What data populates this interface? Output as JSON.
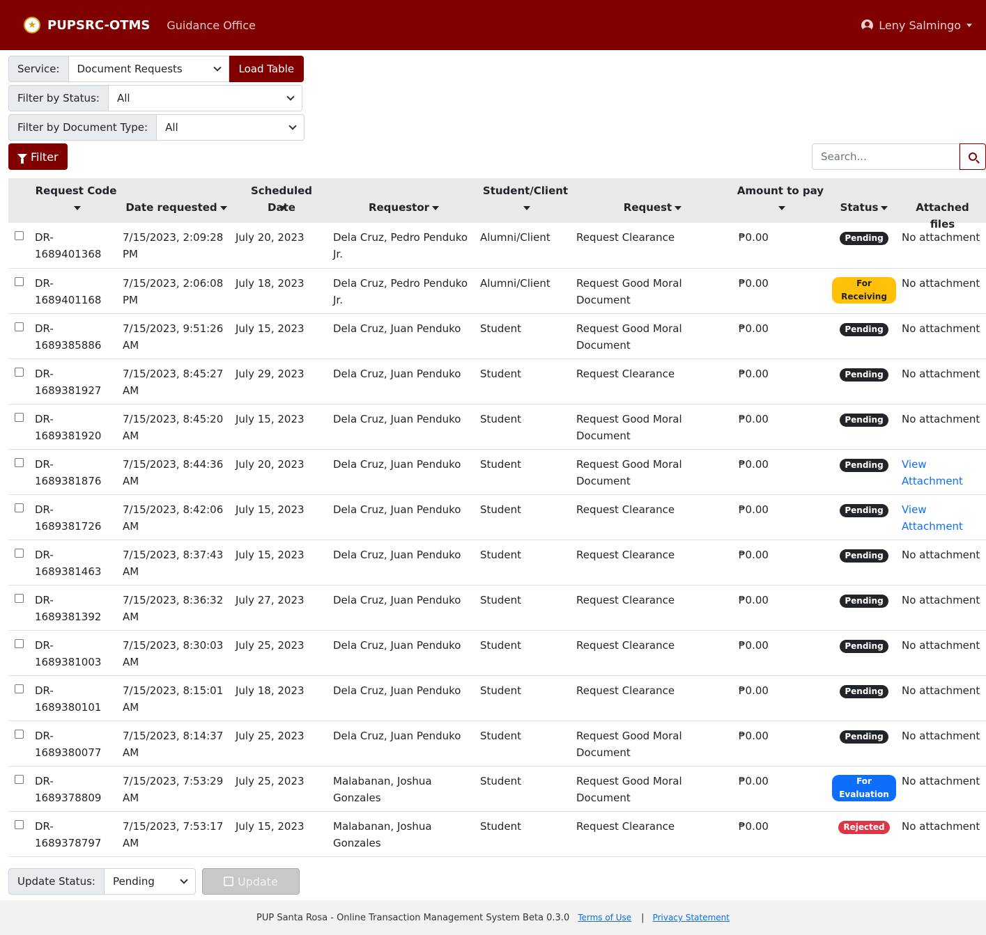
{
  "nav": {
    "brand": "PUPSRC-OTMS",
    "office": "Guidance Office",
    "user": "Leny Salmingo"
  },
  "controls": {
    "service_label": "Service:",
    "service_value": "Document Requests",
    "load_button": "Load Table",
    "status_label": "Filter by Status:",
    "status_value": "All",
    "doctype_label": "Filter by Document Type:",
    "doctype_value": "All",
    "filter_button": "Filter",
    "search_placeholder": "Search..."
  },
  "table": {
    "headers": {
      "code": "Request Code",
      "date": "Date requested",
      "scheduled": "Scheduled Date",
      "requestor": "Requestor",
      "student": "Student/Client",
      "request": "Request",
      "amount": "Amount to pay",
      "status": "Status",
      "files": "Attached files"
    },
    "rows": [
      {
        "code": "DR-1689401368",
        "date": "7/15/2023, 2:09:28 PM",
        "scheduled": "July 20, 2023",
        "requestor": "Dela Cruz, Pedro Penduko Jr.",
        "student": "Alumni/Client",
        "request": "Request Clearance",
        "amount": "₱0.00",
        "status": "Pending",
        "files": "No attachment"
      },
      {
        "code": "DR-1689401168",
        "date": "7/15/2023, 2:06:08 PM",
        "scheduled": "July 18, 2023",
        "requestor": "Dela Cruz, Pedro Penduko Jr.",
        "student": "Alumni/Client",
        "request": "Request Good Moral Document",
        "amount": "₱0.00",
        "status": "For Receiving",
        "files": "No attachment"
      },
      {
        "code": "DR-1689385886",
        "date": "7/15/2023, 9:51:26 AM",
        "scheduled": "July 15, 2023",
        "requestor": "Dela Cruz, Juan Penduko",
        "student": "Student",
        "request": "Request Good Moral Document",
        "amount": "₱0.00",
        "status": "Pending",
        "files": "No attachment"
      },
      {
        "code": "DR-1689381927",
        "date": "7/15/2023, 8:45:27 AM",
        "scheduled": "July 29, 2023",
        "requestor": "Dela Cruz, Juan Penduko",
        "student": "Student",
        "request": "Request Clearance",
        "amount": "₱0.00",
        "status": "Pending",
        "files": "No attachment"
      },
      {
        "code": "DR-1689381920",
        "date": "7/15/2023, 8:45:20 AM",
        "scheduled": "July 15, 2023",
        "requestor": "Dela Cruz, Juan Penduko",
        "student": "Student",
        "request": "Request Good Moral Document",
        "amount": "₱0.00",
        "status": "Pending",
        "files": "No attachment"
      },
      {
        "code": "DR-1689381876",
        "date": "7/15/2023, 8:44:36 AM",
        "scheduled": "July 20, 2023",
        "requestor": "Dela Cruz, Juan Penduko",
        "student": "Student",
        "request": "Request Good Moral Document",
        "amount": "₱0.00",
        "status": "Pending",
        "files": "View Attachment"
      },
      {
        "code": "DR-1689381726",
        "date": "7/15/2023, 8:42:06 AM",
        "scheduled": "July 15, 2023",
        "requestor": "Dela Cruz, Juan Penduko",
        "student": "Student",
        "request": "Request Clearance",
        "amount": "₱0.00",
        "status": "Pending",
        "files": "View Attachment"
      },
      {
        "code": "DR-1689381463",
        "date": "7/15/2023, 8:37:43 AM",
        "scheduled": "July 15, 2023",
        "requestor": "Dela Cruz, Juan Penduko",
        "student": "Student",
        "request": "Request Clearance",
        "amount": "₱0.00",
        "status": "Pending",
        "files": "No attachment"
      },
      {
        "code": "DR-1689381392",
        "date": "7/15/2023, 8:36:32 AM",
        "scheduled": "July 27, 2023",
        "requestor": "Dela Cruz, Juan Penduko",
        "student": "Student",
        "request": "Request Clearance",
        "amount": "₱0.00",
        "status": "Pending",
        "files": "No attachment"
      },
      {
        "code": "DR-1689381003",
        "date": "7/15/2023, 8:30:03 AM",
        "scheduled": "July 25, 2023",
        "requestor": "Dela Cruz, Juan Penduko",
        "student": "Student",
        "request": "Request Clearance",
        "amount": "₱0.00",
        "status": "Pending",
        "files": "No attachment"
      },
      {
        "code": "DR-1689380101",
        "date": "7/15/2023, 8:15:01 AM",
        "scheduled": "July 18, 2023",
        "requestor": "Dela Cruz, Juan Penduko",
        "student": "Student",
        "request": "Request Clearance",
        "amount": "₱0.00",
        "status": "Pending",
        "files": "No attachment"
      },
      {
        "code": "DR-1689380077",
        "date": "7/15/2023, 8:14:37 AM",
        "scheduled": "July 25, 2023",
        "requestor": "Dela Cruz, Juan Penduko",
        "student": "Student",
        "request": "Request Good Moral Document",
        "amount": "₱0.00",
        "status": "Pending",
        "files": "No attachment"
      },
      {
        "code": "DR-1689378809",
        "date": "7/15/2023, 7:53:29 AM",
        "scheduled": "July 25, 2023",
        "requestor": "Malabanan, Joshua Gonzales",
        "student": "Student",
        "request": "Request Good Moral Document",
        "amount": "₱0.00",
        "status": "For Evaluation",
        "files": "No attachment"
      },
      {
        "code": "DR-1689378797",
        "date": "7/15/2023, 7:53:17 AM",
        "scheduled": "July 15, 2023",
        "requestor": "Malabanan, Joshua Gonzales",
        "student": "Student",
        "request": "Request Clearance",
        "amount": "₱0.00",
        "status": "Rejected",
        "files": "No attachment"
      }
    ]
  },
  "update": {
    "label": "Update Status:",
    "value": "Pending",
    "button": "Update"
  },
  "footer": {
    "text": "PUP Santa Rosa - Online Transaction Management System Beta 0.3.0",
    "terms": "Terms of Use",
    "separator": "|",
    "privacy": "Privacy Statement"
  },
  "colors": {
    "brand": "#800000",
    "pending": "#212529",
    "for_receiving": "#ffc107",
    "for_evaluation": "#0d6efd",
    "rejected": "#dc3545"
  }
}
